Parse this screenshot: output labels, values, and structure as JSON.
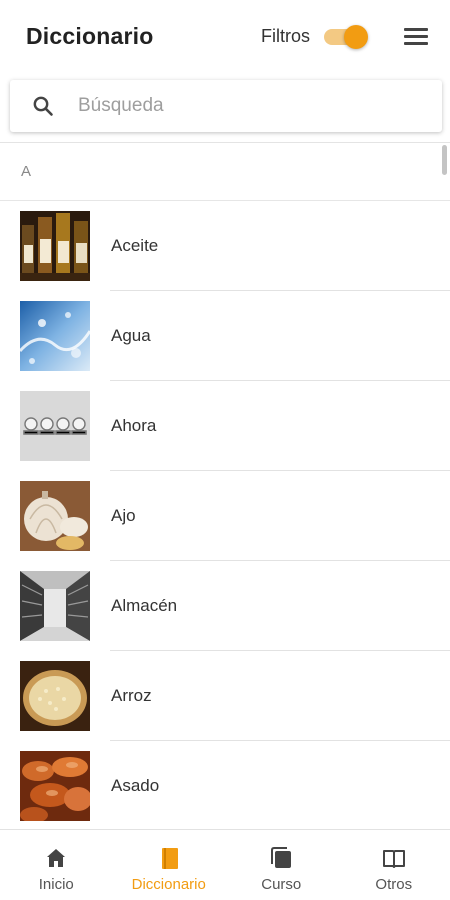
{
  "header": {
    "title": "Diccionario",
    "filter_label": "Filtros",
    "filter_enabled": true,
    "accent_color": "#f29c12"
  },
  "search": {
    "placeholder": "Búsqueda",
    "value": ""
  },
  "list": {
    "section": "A",
    "items": [
      {
        "label": "Aceite",
        "image": "oil-bottles"
      },
      {
        "label": "Agua",
        "image": "water-splash"
      },
      {
        "label": "Ahora",
        "image": "clocks"
      },
      {
        "label": "Ajo",
        "image": "garlic"
      },
      {
        "label": "Almacén",
        "image": "warehouse-shelves"
      },
      {
        "label": "Arroz",
        "image": "rice-bowl"
      },
      {
        "label": "Asado",
        "image": "roast-meat"
      }
    ]
  },
  "bottom_nav": {
    "items": [
      {
        "label": "Inicio",
        "icon": "home-icon",
        "active": false
      },
      {
        "label": "Diccionario",
        "icon": "dictionary-icon",
        "active": true
      },
      {
        "label": "Curso",
        "icon": "course-icon",
        "active": false
      },
      {
        "label": "Otros",
        "icon": "book-open-icon",
        "active": false
      }
    ]
  }
}
